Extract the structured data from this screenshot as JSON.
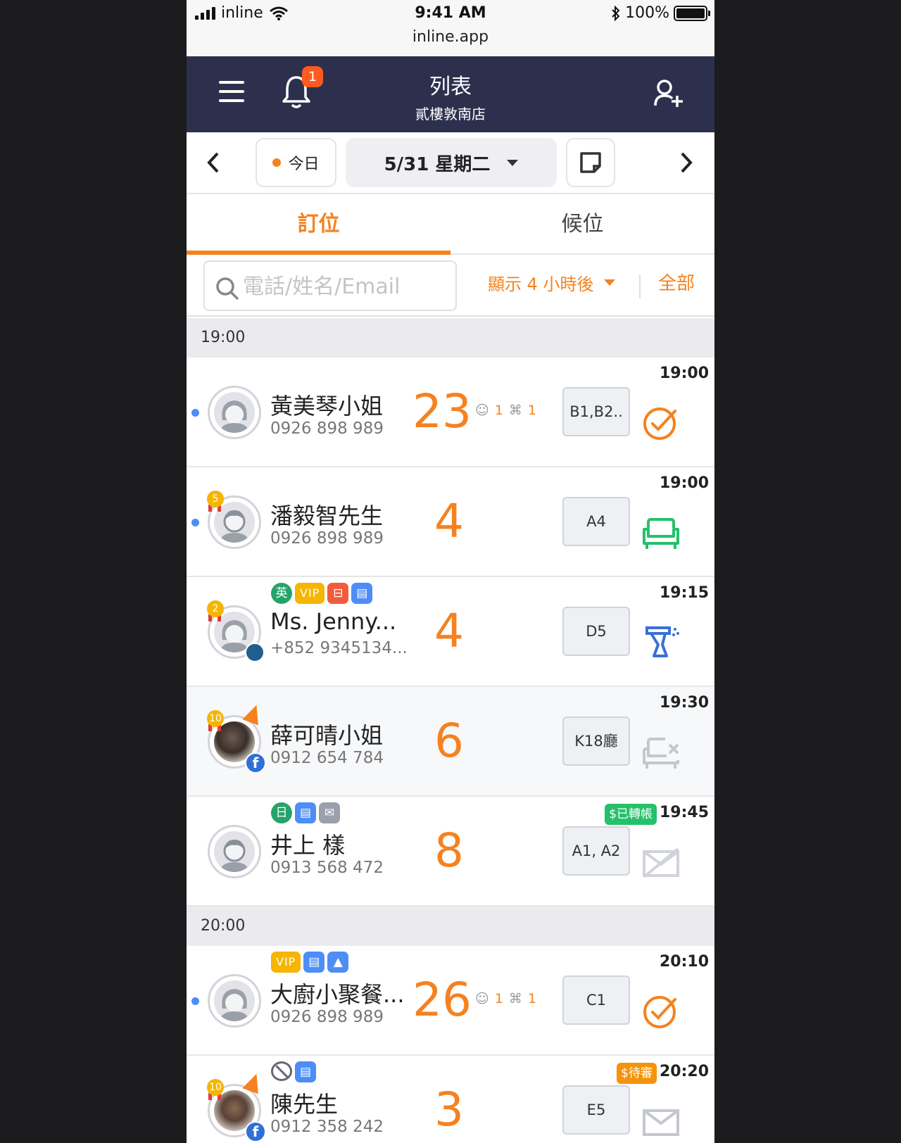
{
  "status_bar": {
    "carrier": "inline",
    "time": "9:41 AM",
    "url": "inline.app",
    "battery": "100%"
  },
  "header": {
    "title": "列表",
    "subtitle": "貳樓敦南店",
    "notification_count": "1"
  },
  "date_bar": {
    "today_label": "今日",
    "date_label": "5/31 星期二"
  },
  "tabs": [
    {
      "label": "訂位",
      "active": true
    },
    {
      "label": "候位",
      "active": false
    }
  ],
  "search": {
    "placeholder": "電話/姓名/Email",
    "value": ""
  },
  "filter": {
    "label": "顯示 4 小時後",
    "all_label": "全部"
  },
  "sections": [
    {
      "time": "19:00",
      "rows": [
        {
          "name": "黃美琴小姐",
          "phone": "0926 898 989",
          "party": "23",
          "kids": "1",
          "highchairs": "1",
          "table": "B1,B2..",
          "time": "19:00",
          "status": "checked",
          "new": true,
          "avatar": "female"
        },
        {
          "name": "潘毅智先生",
          "phone": "0926 898 989",
          "party": "4",
          "table": "A4",
          "time": "19:00",
          "status": "seated",
          "new": true,
          "avatar": "male",
          "level": "5"
        },
        {
          "name": "Ms. Jenny...",
          "phone": "+852 9345134...",
          "party": "4",
          "table": "D5",
          "time": "19:15",
          "status": "cleaning",
          "avatar": "female",
          "level": "2",
          "tags": [
            "英",
            "VIP",
            "ticket",
            "note"
          ]
        },
        {
          "name": "薛可晴小姐",
          "phone": "0912 654 784",
          "party": "6",
          "table": "K18廳",
          "time": "19:30",
          "status": "no-show",
          "avatar": "photo",
          "level": "10",
          "source": "f"
        },
        {
          "name": "井上 樣",
          "phone": "0913 568 472",
          "party": "8",
          "table": "A1, A2",
          "time": "19:45",
          "status": "unsent",
          "avatar": "male",
          "payment": "$已轉帳",
          "tags": [
            "日",
            "note",
            "mail"
          ]
        }
      ]
    },
    {
      "time": "20:00",
      "rows": [
        {
          "name": "大廚小聚餐...",
          "phone": "0926 898 989",
          "party": "26",
          "kids": "1",
          "highchairs": "1",
          "table": "C1",
          "time": "20:10",
          "status": "checked",
          "new": true,
          "avatar": "female",
          "tags": [
            "VIP",
            "note",
            "image"
          ]
        },
        {
          "name": "陳先生",
          "phone": "0912 358 242",
          "party": "3",
          "table": "E5",
          "time": "20:20",
          "status": "mail",
          "avatar": "photo",
          "level": "10",
          "source": "f",
          "payment": "$待審",
          "tags": [
            "ban",
            "note"
          ]
        }
      ]
    }
  ],
  "colors": {
    "nav_bg": "#2d304d",
    "accent": "#f5821f",
    "seated": "#25c06a",
    "cleaning": "#3a6fd8",
    "dot": "#4d8df6"
  }
}
